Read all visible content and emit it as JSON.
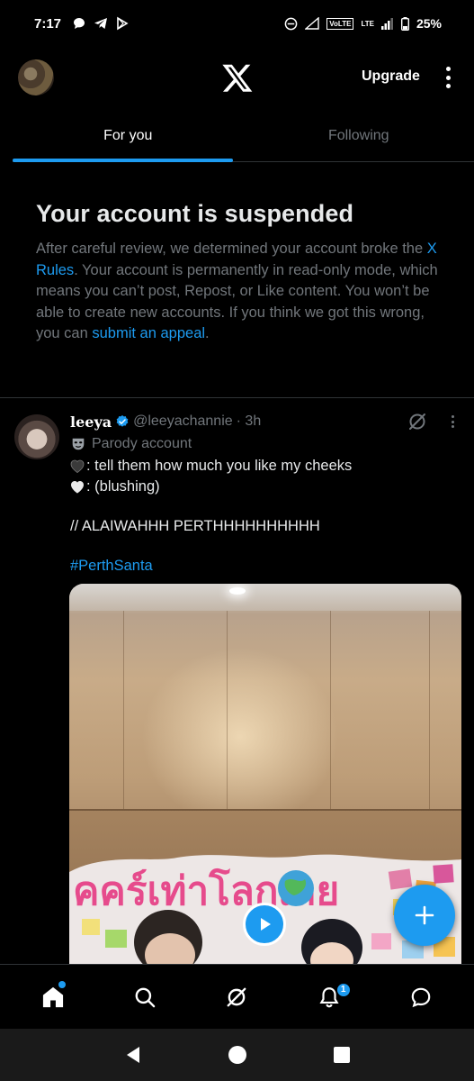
{
  "status_bar": {
    "time": "7:17",
    "network_volte": "VoLTE",
    "network_lte": "LTE",
    "battery": "25%"
  },
  "header": {
    "upgrade_label": "Upgrade"
  },
  "tabs": [
    {
      "label": "For you",
      "active": true
    },
    {
      "label": "Following",
      "active": false
    }
  ],
  "notice": {
    "title": "Your account is suspended",
    "text_1": "After careful review, we determined your account broke the ",
    "link_rules": "X Rules",
    "text_2": ". Your account is permanently in read-only mode, which means you can’t post, Repost, or Like content. You won’t be able to create new accounts. If you think we got this wrong, you can ",
    "link_appeal": "submit an appeal",
    "text_3": "."
  },
  "tweet": {
    "name": "leeya",
    "handle": "@leeyachannie",
    "time": "· 3h",
    "label": "Parody account",
    "line_1": ": tell them how much you like my cheeks",
    "line_2": ": (blushing)",
    "line_3": "// ALAIWAHHH PERTHHHHHHHHHH",
    "hashtag": "#PerthSanta",
    "banner_text": "คคร์เท่าโลกเลย"
  },
  "bottom_nav": {
    "notifications_badge": "1"
  },
  "colors": {
    "accent": "#1d9bf0",
    "background": "#000000",
    "muted": "#71767b",
    "text": "#e7e9ea"
  }
}
